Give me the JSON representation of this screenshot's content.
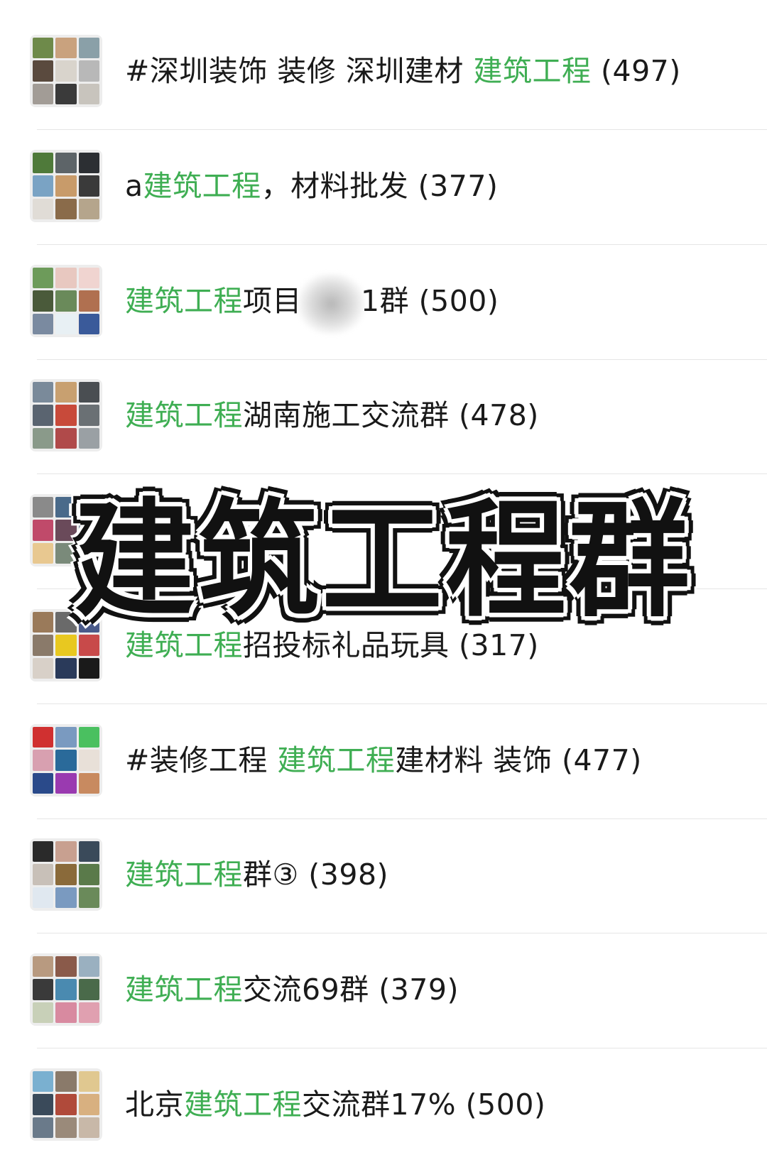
{
  "keyword": "建筑工程",
  "accent_color": "#3fae53",
  "overlay_title": "建筑工程群",
  "rows": [
    {
      "parts": [
        {
          "t": "#深圳装饰 装修 深圳建材 "
        },
        {
          "t": "建筑工程",
          "kw": true
        },
        {
          "t": " (497)"
        }
      ],
      "tiles": [
        "#6e8a4a",
        "#c9a27e",
        "#8aa0a8",
        "#5a4a3e",
        "#d9d4cc",
        "#b8b8b8",
        "#a29c96",
        "#3a3a3a",
        "#c8c4bd"
      ]
    },
    {
      "parts": [
        {
          "t": "a"
        },
        {
          "t": "建筑工程",
          "kw": true
        },
        {
          "t": "，材料批发 (377)"
        }
      ],
      "tiles": [
        "#4f7a3a",
        "#5d6468",
        "#2c2f33",
        "#7aa3c4",
        "#c89b6a",
        "#3a3a3a",
        "#e0dcd6",
        "#8a6b4a",
        "#b5a58c"
      ]
    },
    {
      "parts": [
        {
          "t": "建筑工程",
          "kw": true
        },
        {
          "t": "项目"
        },
        {
          "t": "货款",
          "blur": true
        },
        {
          "t": "1群 (500)"
        }
      ],
      "tiles": [
        "#6d9b5a",
        "#e8c8c0",
        "#f0d4d0",
        "#4a5a3a",
        "#6a8a5a",
        "#b07050",
        "#7a8aa0",
        "#e8f0f4",
        "#3a5a9a"
      ]
    },
    {
      "parts": [
        {
          "t": "建筑工程",
          "kw": true
        },
        {
          "t": "湖南施工交流群 (478)"
        }
      ],
      "tiles": [
        "#7a8a9a",
        "#c8a070",
        "#4a4e52",
        "#5a6470",
        "#c84a3a",
        "#6a7074",
        "#8a9a8a",
        "#b04a4a",
        "#9aa0a4"
      ]
    },
    {
      "parts": [
        {
          "t": "建筑工程",
          "kw": true
        },
        {
          "t": "·四群"
        }
      ],
      "tiles": [
        "#8a8a8a",
        "#4a6a8a",
        "#d0d0d0",
        "#c04a6a",
        "#6a4a5a",
        "#8a9aaa",
        "#e8c890",
        "#7a8a7a",
        "#5a6a7a"
      ]
    },
    {
      "parts": [
        {
          "t": "建筑工程",
          "kw": true
        },
        {
          "t": "招投标礼品玩具 (317)"
        }
      ],
      "tiles": [
        "#9a7a5a",
        "#6a6a6a",
        "#4a5a8a",
        "#8a7a6a",
        "#e8c820",
        "#c84a4a",
        "#d8d0c8",
        "#2a3a5a",
        "#1a1a1a"
      ]
    },
    {
      "parts": [
        {
          "t": "#装修工程 "
        },
        {
          "t": "建筑工程",
          "kw": true
        },
        {
          "t": "建材料 装饰 (477)"
        }
      ],
      "tiles": [
        "#d03030",
        "#7a9ac0",
        "#4ac060",
        "#d8a0b0",
        "#2a6a9a",
        "#e8e0d8",
        "#2a4a8a",
        "#9a3ab0",
        "#c88a60"
      ]
    },
    {
      "parts": [
        {
          "t": "建筑工程",
          "kw": true
        },
        {
          "t": "群③ (398)"
        }
      ],
      "tiles": [
        "#2a2a2a",
        "#c8a090",
        "#3a4a5a",
        "#c8c0b8",
        "#8a6a3a",
        "#5a7a4a",
        "#e0e8f0",
        "#7a9ac0",
        "#6a8a5a"
      ]
    },
    {
      "parts": [
        {
          "t": "建筑工程",
          "kw": true
        },
        {
          "t": "交流69群 (379)"
        }
      ],
      "tiles": [
        "#b89a80",
        "#8a5a4a",
        "#9ab0c0",
        "#3a3a3a",
        "#4a8ab0",
        "#4a6a4a",
        "#c8d0b8",
        "#d88aa0",
        "#e0a0b0"
      ]
    },
    {
      "parts": [
        {
          "t": "北京"
        },
        {
          "t": "建筑工程",
          "kw": true
        },
        {
          "t": "交流群17% (500)"
        }
      ],
      "tiles": [
        "#7ab0d0",
        "#8a7a6a",
        "#e0c890",
        "#3a4a5a",
        "#b04a3a",
        "#d8b080",
        "#6a7a8a",
        "#9a8a7a",
        "#c8b8a8"
      ]
    }
  ]
}
